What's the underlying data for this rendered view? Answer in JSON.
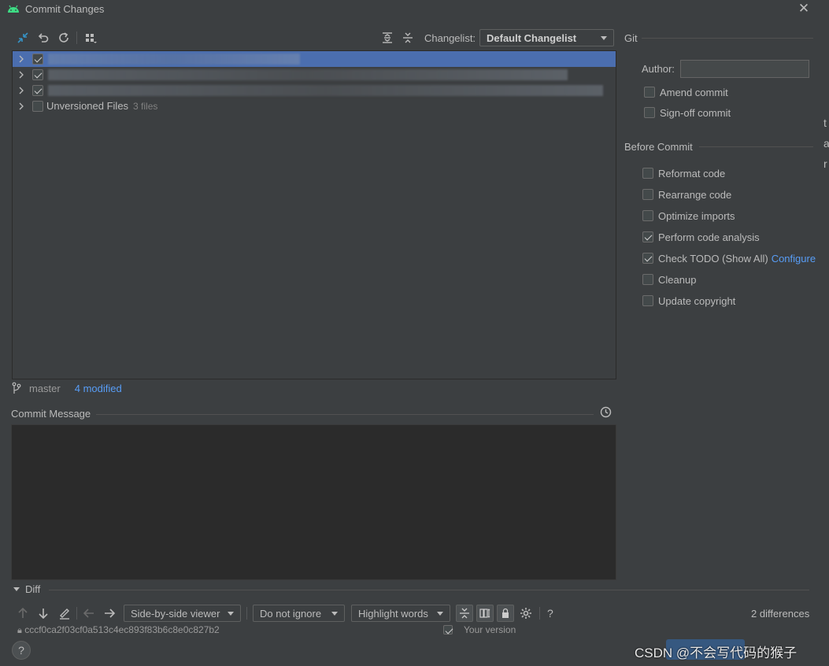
{
  "window": {
    "title": "Commit Changes"
  },
  "toolbar": {
    "changelist_label": "Changelist:",
    "changelist_value": "Default Changelist"
  },
  "tree": {
    "rows": [
      {
        "checked": true,
        "selected": true,
        "label": ""
      },
      {
        "checked": true,
        "selected": false,
        "label": ""
      },
      {
        "checked": true,
        "selected": false,
        "label": ""
      },
      {
        "checked": false,
        "selected": false,
        "label": "Unversioned Files",
        "count": "3 files"
      }
    ]
  },
  "branch": {
    "name": "master",
    "modified": "4 modified"
  },
  "commit_message": {
    "label": "Commit Message",
    "value": ""
  },
  "git": {
    "header": "Git",
    "author_label": "Author:",
    "author_value": "",
    "amend": "Amend commit",
    "signoff": "Sign-off commit"
  },
  "before_commit": {
    "header": "Before Commit",
    "options": [
      {
        "label": "Reformat code",
        "checked": false
      },
      {
        "label": "Rearrange code",
        "checked": false
      },
      {
        "label": "Optimize imports",
        "checked": false
      },
      {
        "label": "Perform code analysis",
        "checked": true
      },
      {
        "label": "Check TODO (Show All)",
        "checked": true,
        "link": "Configure"
      },
      {
        "label": "Cleanup",
        "checked": false
      },
      {
        "label": "Update copyright",
        "checked": false
      }
    ]
  },
  "diff": {
    "header": "Diff",
    "viewer": "Side-by-side viewer",
    "ignore": "Do not ignore",
    "highlight": "Highlight words",
    "help": "?",
    "differences": "2 differences",
    "hash": "cccf0ca2f03cf0a513c4ec893f83b6c8e0c827b2",
    "your_version": "Your version"
  },
  "footer": {
    "help": "?",
    "watermark": "CSDN @不会写代码的猴子"
  },
  "edge_letters": [
    "t",
    "a",
    "r"
  ],
  "colors": {
    "background": "#3c3f41",
    "selection": "#4b6eaf",
    "link": "#589df6",
    "android_green": "#3ddc84"
  }
}
